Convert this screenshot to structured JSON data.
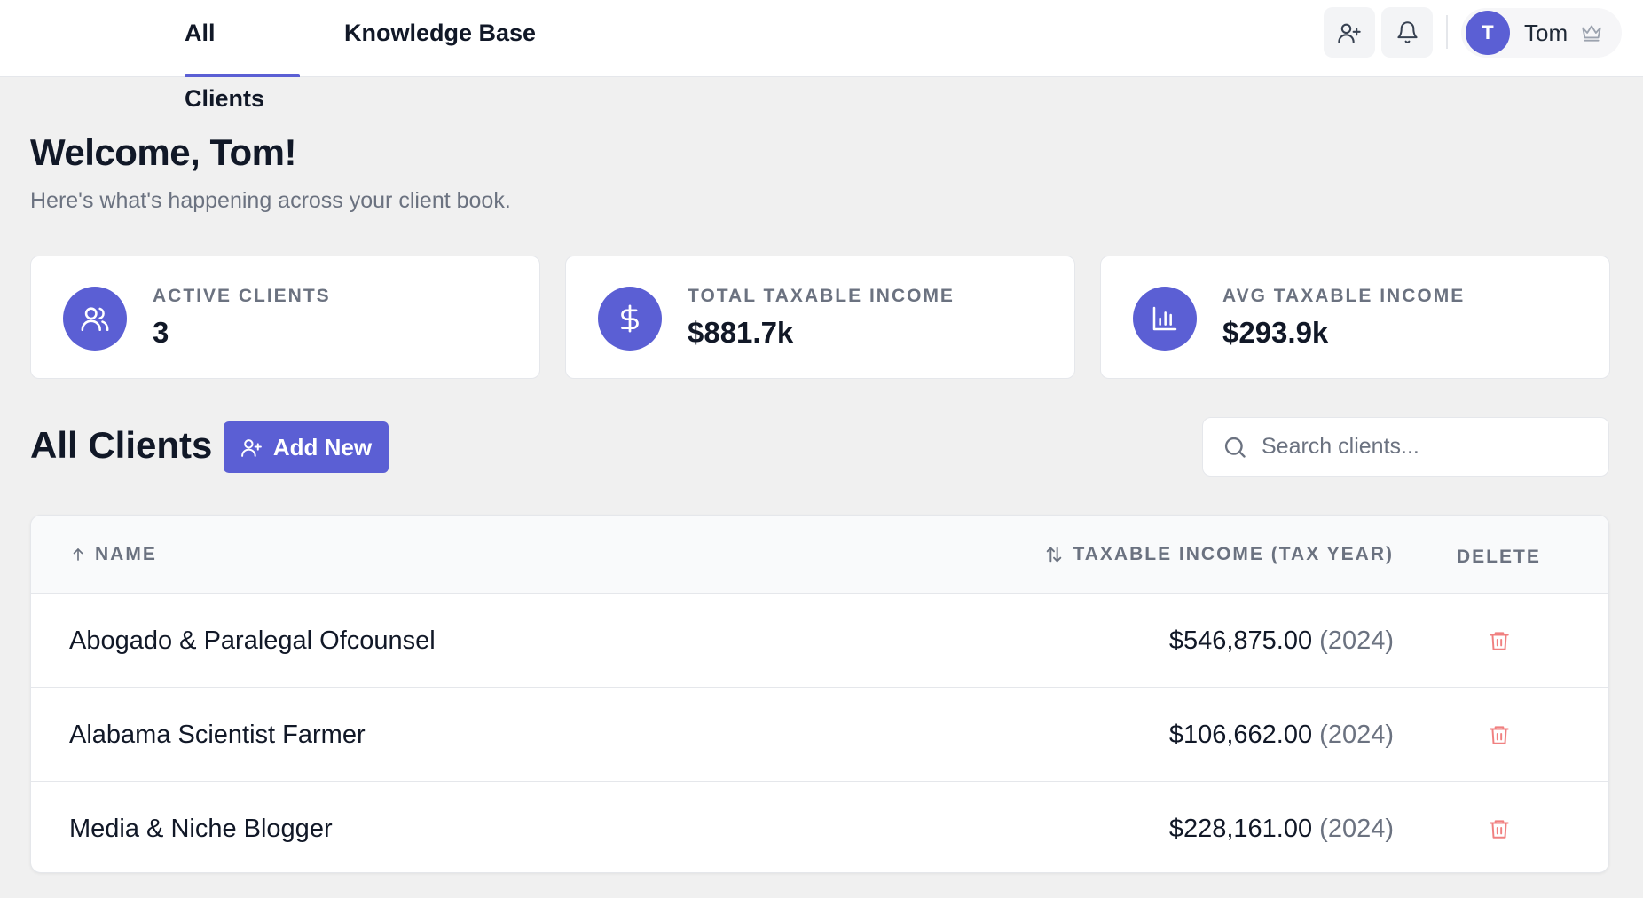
{
  "nav": {
    "tabs": [
      {
        "label": "All Clients",
        "active": true
      },
      {
        "label": "Knowledge Base",
        "active": false
      }
    ],
    "actions": [
      "add-user-icon",
      "bell-icon"
    ],
    "user": {
      "initial": "T",
      "name": "Tom",
      "badge_icon": "crown-icon"
    }
  },
  "header": {
    "title": "Welcome, Tom!",
    "subtitle": "Here's what's happening across your client book."
  },
  "stats": [
    {
      "icon": "users-icon",
      "label": "ACTIVE CLIENTS",
      "value": "3"
    },
    {
      "icon": "dollar-icon",
      "label": "TOTAL TAXABLE INCOME",
      "value": "$881.7k"
    },
    {
      "icon": "bar-chart-icon",
      "label": "AVG TAXABLE INCOME",
      "value": "$293.9k"
    }
  ],
  "clients_section": {
    "title": "All Clients",
    "add_button": "Add New",
    "search_placeholder": "Search clients..."
  },
  "table": {
    "columns": {
      "name": "NAME",
      "income": "TAXABLE INCOME (TAX YEAR)",
      "delete": "DELETE"
    },
    "rows": [
      {
        "name": "Abogado & Paralegal Ofcounsel",
        "amount": "$546,875.00",
        "year": "(2024)"
      },
      {
        "name": "Alabama Scientist Farmer",
        "amount": "$106,662.00",
        "year": "(2024)"
      },
      {
        "name": "Media & Niche Blogger",
        "amount": "$228,161.00",
        "year": "(2024)"
      }
    ]
  },
  "colors": {
    "accent": "#5b5fd4",
    "background": "#f0f0f0",
    "delete": "#f08080",
    "muted_text": "#6b7280"
  }
}
